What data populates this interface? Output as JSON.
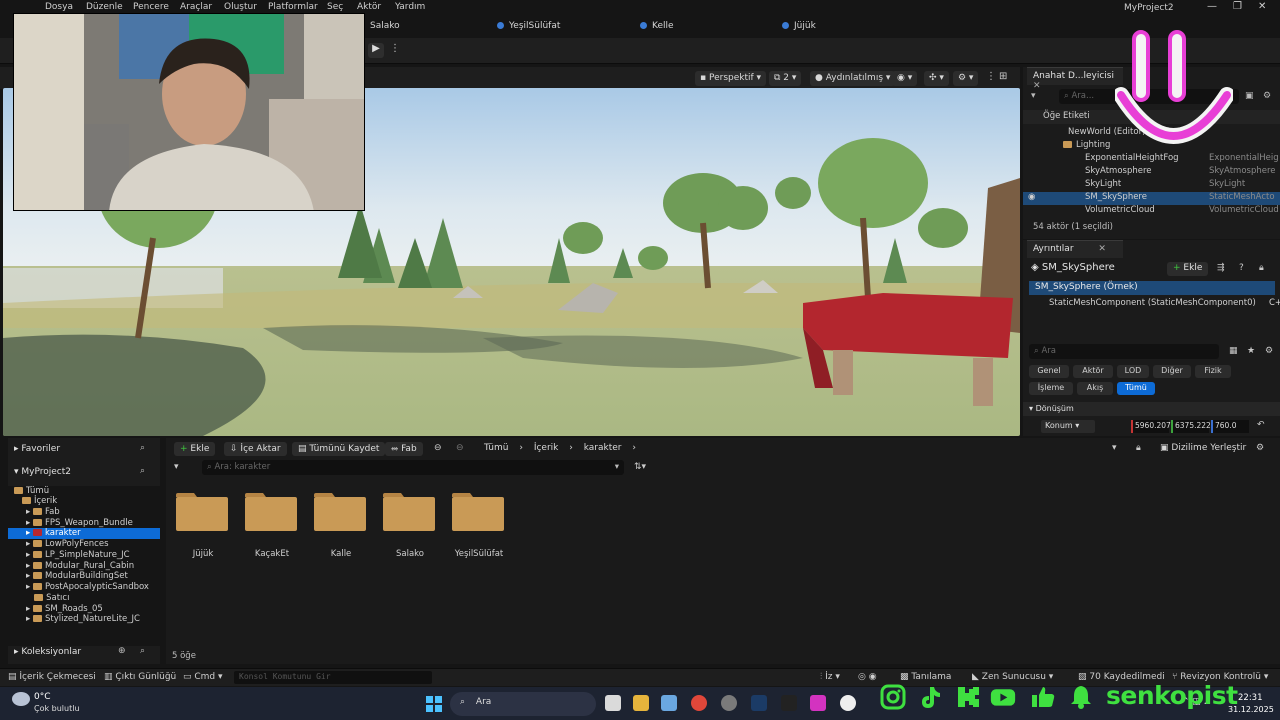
{
  "menu": [
    "Dosya",
    "Düzenle",
    "Pencere",
    "Araçlar",
    "Oluştur",
    "Platformlar",
    "Seç",
    "Aktör",
    "Yardım"
  ],
  "project_title": "MyProject2",
  "doc_tabs": [
    "Salako",
    "YeşilSülüfat",
    "Kelle",
    "Jüjük"
  ],
  "viewport": {
    "perspective": "Perspektif",
    "count": "2",
    "lit": "Aydınlatılmış"
  },
  "outliner": {
    "tab": "Anahat D...leyicisi",
    "search_placeholder": "Ara...",
    "column_label": "Öğe Etiketi",
    "rows": [
      {
        "label": "NewWorld (Editor)",
        "type": ""
      },
      {
        "label": "Lighting",
        "type": ""
      },
      {
        "label": "ExponentialHeightFog",
        "type": "ExponentialHeig"
      },
      {
        "label": "SkyAtmosphere",
        "type": "SkyAtmosphere"
      },
      {
        "label": "SkyLight",
        "type": "SkyLight"
      },
      {
        "label": "SM_SkySphere",
        "type": "StaticMeshActo"
      },
      {
        "label": "VolumetricCloud",
        "type": "VolumetricCloud"
      }
    ],
    "footer": "54 aktör (1 seçildi)"
  },
  "details": {
    "tab": "Ayrıntılar",
    "object": "SM_SkySphere",
    "add_label": "Ekle",
    "instance": "SM_SkySphere (Örnek)",
    "component": "StaticMeshComponent (StaticMeshComponent0)",
    "component_suffix": "C++",
    "search_placeholder": "Ara",
    "filters": [
      "Genel",
      "Aktör",
      "LOD",
      "Diğer",
      "Fizik",
      "İşleme",
      "Akış",
      "Tümü"
    ],
    "section": "Dönüşüm",
    "location_label": "Konum",
    "loc_x": "5960.207",
    "loc_y": "6375.222",
    "loc_z": "760.0"
  },
  "content_browser": {
    "favorites": "Favoriler",
    "project": "MyProject2",
    "collections": "Koleksiyonlar",
    "tree": [
      {
        "label": "Tümü",
        "indent": 0
      },
      {
        "label": "İçerik",
        "indent": 1
      },
      {
        "label": "Fab",
        "indent": 2
      },
      {
        "label": "FPS_Weapon_Bundle",
        "indent": 2
      },
      {
        "label": "karakter",
        "indent": 2
      },
      {
        "label": "LowPolyFences",
        "indent": 2
      },
      {
        "label": "LP_SimpleNature_JC",
        "indent": 2
      },
      {
        "label": "Modular_Rural_Cabin",
        "indent": 2
      },
      {
        "label": "ModularBuildingSet",
        "indent": 2
      },
      {
        "label": "PostApocalypticSandbox",
        "indent": 2
      },
      {
        "label": "Satıcı",
        "indent": 2
      },
      {
        "label": "SM_Roads_05",
        "indent": 2
      },
      {
        "label": "Stylized_NatureLite_JC",
        "indent": 2
      }
    ],
    "buttons": {
      "add": "Ekle",
      "import": "İçe Aktar",
      "save_all": "Tümünü Kaydet",
      "fab": "Fab"
    },
    "breadcrumb": [
      "Tümü",
      "İçerik",
      "karakter"
    ],
    "dock_label": "Dizilime Yerleştir",
    "search_placeholder": "Ara: karakter",
    "folders": [
      "Jüjük",
      "KaçakEt",
      "Kalle",
      "Salako",
      "YeşilSülüfat"
    ],
    "item_count": "5 öğe"
  },
  "statusbar": {
    "content_drawer": "İçerik Çekmecesi",
    "output_log": "Çıktı Günlüğü",
    "cmd": "Cmd",
    "console_placeholder": "Konsol Komutunu Gir",
    "trace": "İz",
    "diagnostics": "Tanılama",
    "zen": "Zen Sunucusu",
    "saved": "70 Kaydedilmedi",
    "revision": "Revizyon Kontrolü"
  },
  "taskbar": {
    "weather_temp": "0°C",
    "weather_desc": "Çok bulutlu",
    "search": "Ara",
    "time": "22:31",
    "date": "31.12.2025"
  },
  "overlay": {
    "handle": "senkopist"
  },
  "colors": {
    "accent": "#0d6bd6",
    "folder": "#c99a56",
    "smile": "#e83fd6",
    "social_green": "#3fe040"
  }
}
